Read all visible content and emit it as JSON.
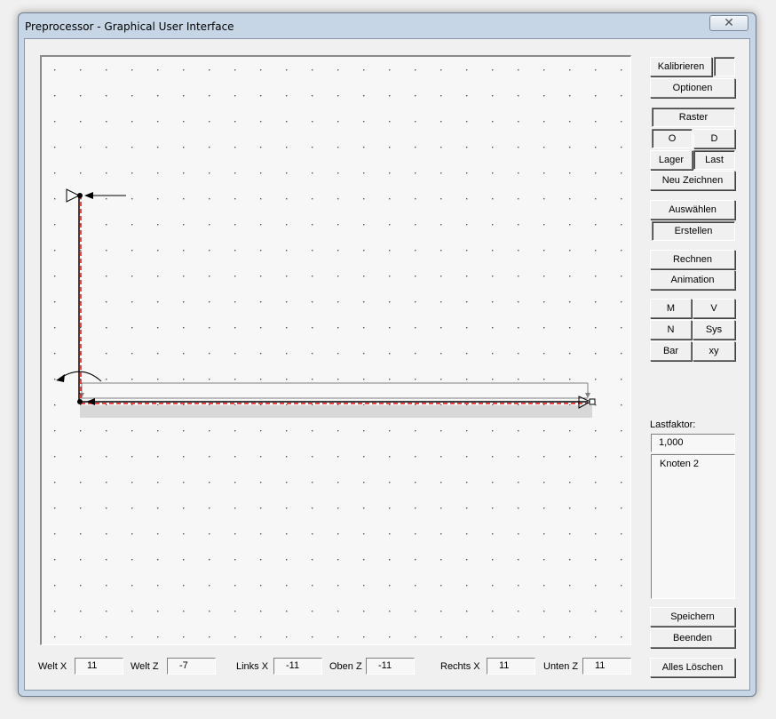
{
  "window": {
    "title": "Preprocessor - Graphical User Interface",
    "close_glyph": "✕"
  },
  "buttons": {
    "kalibrieren": "Kalibrieren",
    "optionen": "Optionen",
    "raster": "Raster",
    "o": "O",
    "d": "D",
    "lager": "Lager",
    "last": "Last",
    "neu_zeichnen": "Neu Zeichnen",
    "auswaehlen": "Auswählen",
    "erstellen": "Erstellen",
    "rechnen": "Rechnen",
    "animation": "Animation",
    "m": "M",
    "v": "V",
    "n": "N",
    "sys": "Sys",
    "bar": "Bar",
    "xy": "xy",
    "speichern": "Speichern",
    "beenden": "Beenden",
    "alles_loeschen": "Alles Löschen"
  },
  "lastfaktor": {
    "label": "Lastfaktor:",
    "value": "1,000"
  },
  "list": {
    "items": [
      "Knoten 2"
    ]
  },
  "status": {
    "welt_x": {
      "label": "Welt X",
      "value": "11"
    },
    "welt_z": {
      "label": "Welt Z",
      "value": "-7"
    },
    "links_x": {
      "label": "Links X",
      "value": "-11"
    },
    "oben_z": {
      "label": "Oben Z",
      "value": "-11"
    },
    "rechts_x": {
      "label": "Rechts X",
      "value": "11"
    },
    "unten_z": {
      "label": "Unten Z",
      "value": "11"
    }
  },
  "colors": {
    "member": "#ff0000",
    "support": "#000000",
    "load": "#808080"
  },
  "icons": [
    "close-icon",
    "fixed-support-icon",
    "moment-arrow-icon",
    "load-arrow-icon"
  ]
}
